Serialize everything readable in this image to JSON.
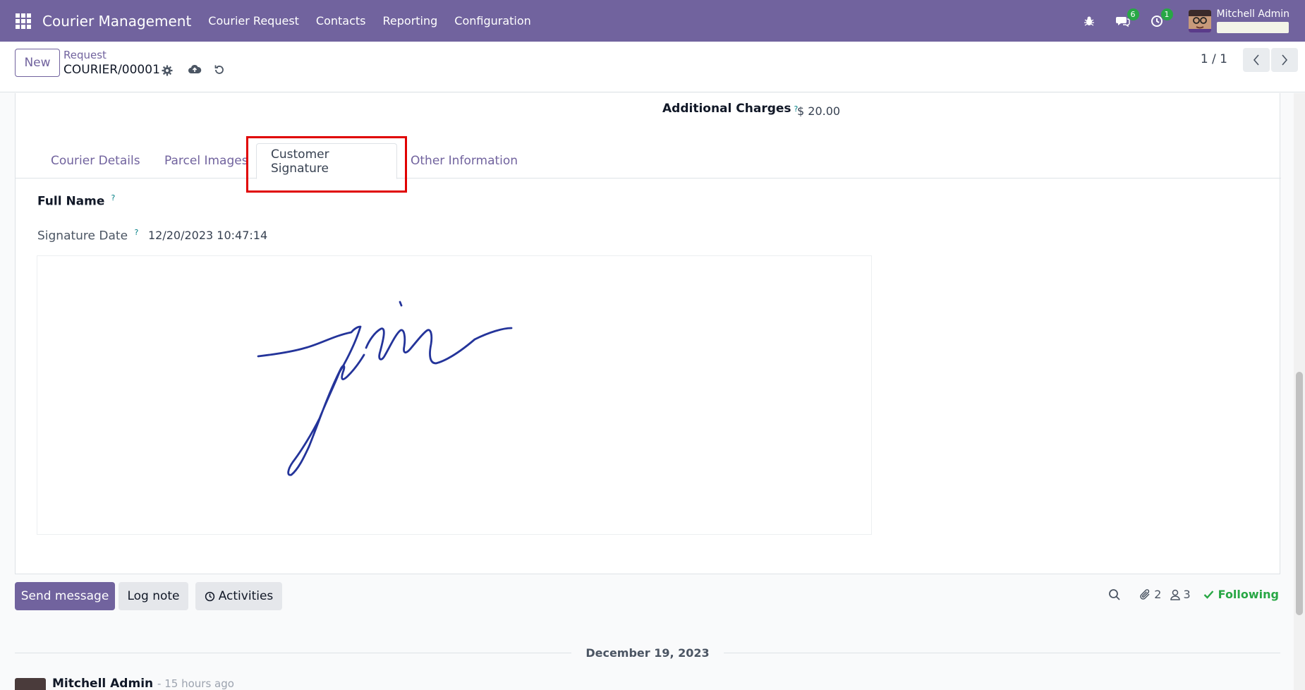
{
  "navbar": {
    "app_title": "Courier Management",
    "menu": [
      "Courier Request",
      "Contacts",
      "Reporting",
      "Configuration"
    ],
    "messages_count": "6",
    "activities_count": "1",
    "user_name": "Mitchell Admin"
  },
  "control_panel": {
    "new_label": "New",
    "breadcrumb": "Request",
    "record_name": "COURIER/00001",
    "pager": "1 / 1"
  },
  "form": {
    "additional_charges_label": "Additional Charges",
    "additional_charges_value": "$ 20.00",
    "tooltip": "?",
    "tabs": [
      "Courier Details",
      "Parcel Images",
      "Customer Signature",
      "Other Information"
    ],
    "active_tab": "Customer Signature",
    "full_name_label": "Full Name",
    "signature_date_label": "Signature Date",
    "signature_date_value": "12/20/2023 10:47:14",
    "signature_color": "#24349a"
  },
  "chatter": {
    "send_message": "Send message",
    "log_note": "Log note",
    "activities": "Activities",
    "attachments_count": "2",
    "followers_count": "3",
    "following_label": "Following",
    "date_separator": "December 19, 2023",
    "author": "Mitchell Admin",
    "time": "- 15 hours ago"
  },
  "colors": {
    "brand": "#71639e",
    "highlight": "#e00000",
    "success": "#28a745"
  }
}
